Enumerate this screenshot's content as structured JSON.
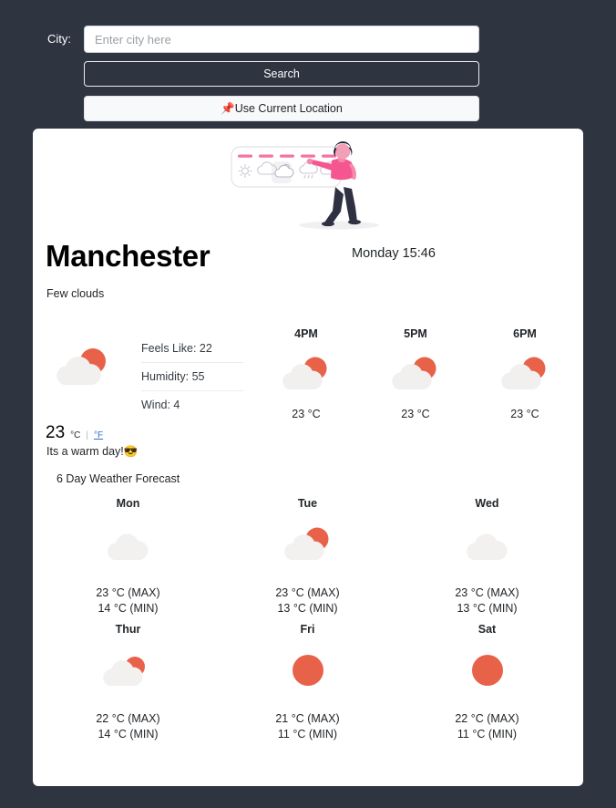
{
  "search": {
    "city_label": "City:",
    "input_value": "",
    "input_placeholder": "Enter city here",
    "search_button": "Search",
    "location_button": "Use Current Location",
    "location_icon": "pushpin-icon",
    "location_emoji": "📌"
  },
  "illustration": {
    "name": "weather-widget-illustration",
    "accent": "#f573a0",
    "person_shirt": "#f5568f",
    "person_pants": "#2f3143",
    "panel_bg": "#ffffff",
    "highlight_cell_index": 2
  },
  "current": {
    "city": "Manchester",
    "datetime": "Monday 15:46",
    "description": "Few clouds",
    "message": "Its a warm day!😎",
    "icon": "sun-behind-cloud-icon",
    "temperature": "23",
    "unit_active": "°C",
    "unit_separator": "|",
    "unit_alternate": "°F",
    "stats": [
      {
        "label": "Feels Like: 22"
      },
      {
        "label": "Humidity: 55"
      },
      {
        "label": "Wind: 4"
      }
    ]
  },
  "hourly": [
    {
      "time": "4PM",
      "icon": "sun-behind-cloud-icon",
      "temp": "23 °C"
    },
    {
      "time": "5PM",
      "icon": "sun-behind-cloud-icon",
      "temp": "23 °C"
    },
    {
      "time": "6PM",
      "icon": "sun-behind-cloud-icon",
      "temp": "23 °C"
    }
  ],
  "forecast": {
    "title": "6 Day Weather Forecast",
    "days": [
      {
        "day": "Mon",
        "icon": "cloud-icon",
        "max": "23 °C (MAX)",
        "min": "14 °C (MIN)"
      },
      {
        "day": "Tue",
        "icon": "sun-behind-cloud-icon",
        "max": "23 °C (MAX)",
        "min": "13 °C (MIN)"
      },
      {
        "day": "Wed",
        "icon": "cloud-icon",
        "max": "23 °C (MAX)",
        "min": "13 °C (MIN)"
      },
      {
        "day": "Thur",
        "icon": "sun-behind-cloud-icon",
        "max": "22 °C (MAX)",
        "min": "14 °C (MIN)"
      },
      {
        "day": "Fri",
        "icon": "sun-icon",
        "max": "21 °C (MAX)",
        "min": "11 °C (MIN)"
      },
      {
        "day": "Sat",
        "icon": "sun-icon",
        "max": "22 °C (MAX)",
        "min": "11 °C (MIN)"
      }
    ]
  },
  "colors": {
    "page_background": "#2e3440",
    "card_background": "#ffffff",
    "sun": "#e8624a",
    "cloud": "#f1f0ef",
    "link": "#2f6fd0"
  }
}
